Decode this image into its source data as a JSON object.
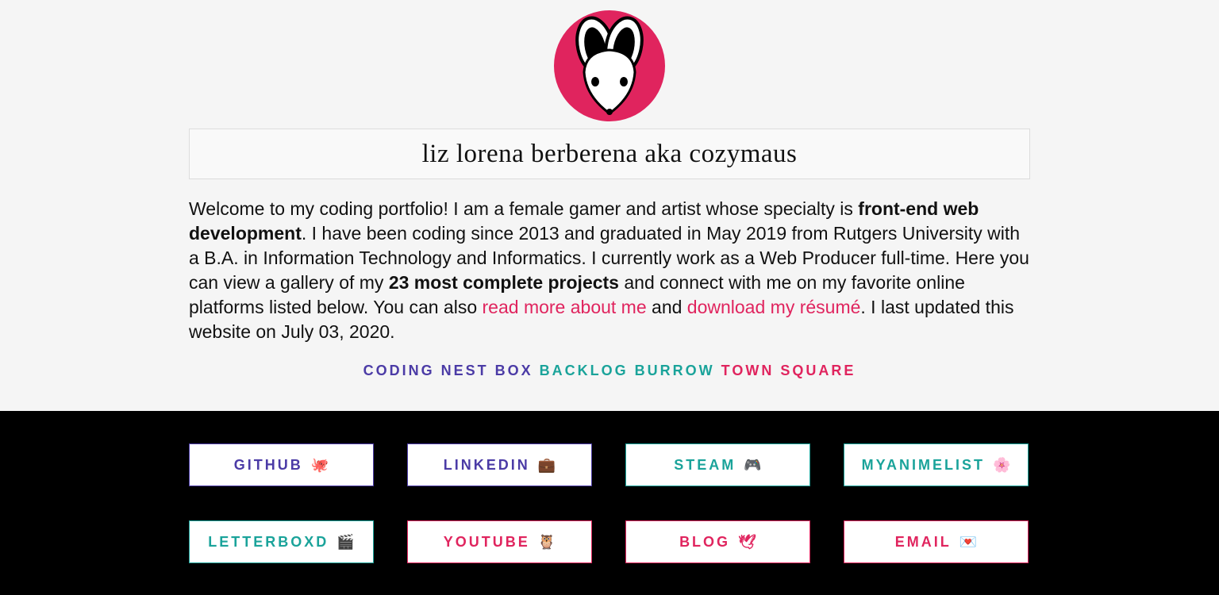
{
  "header": {
    "title": "liz lorena berberena aka cozymaus"
  },
  "intro": {
    "p1": "Welcome to my coding portfolio! I am a female gamer and artist whose specialty is ",
    "b1": "front-end web development",
    "p2": ". I have been coding since 2013 and graduated in May 2019 from Rutgers University with a B.A. in Information Technology and Informatics. I currently work as a Web Producer full-time. Here you can view a gallery of my ",
    "b2": "23 most complete projects",
    "p3": " and connect with me on my favorite online platforms listed below. You can also ",
    "link_about": "read more about me",
    "p4": " and ",
    "link_resume": "download my résumé",
    "p5": ". I last updated this website on July 03, 2020."
  },
  "nav": {
    "coding": "CODING NEST BOX",
    "backlog": "BACKLOG BURROW",
    "town": "TOWN SQUARE"
  },
  "social": [
    {
      "label": "GITHUB",
      "icon": "🐙",
      "icon_name": "octopus-icon"
    },
    {
      "label": "LINKEDIN",
      "icon": "💼",
      "icon_name": "briefcase-icon"
    },
    {
      "label": "STEAM",
      "icon": "🎮",
      "icon_name": "game-controller-icon"
    },
    {
      "label": "MYANIMELIST",
      "icon": "🌸",
      "icon_name": "cherry-blossom-icon"
    },
    {
      "label": "LETTERBOXD",
      "icon": "🎬",
      "icon_name": "clapper-board-icon"
    },
    {
      "label": "YOUTUBE",
      "icon": "🦉",
      "icon_name": "owl-icon"
    },
    {
      "label": "BLOG",
      "icon": "🕊",
      "icon_name": "dove-icon"
    },
    {
      "label": "EMAIL",
      "icon": "💌",
      "icon_name": "love-letter-icon"
    }
  ],
  "colors": {
    "purple": "#4b3ba6",
    "teal": "#1aa39a",
    "pink": "#e0245e"
  }
}
